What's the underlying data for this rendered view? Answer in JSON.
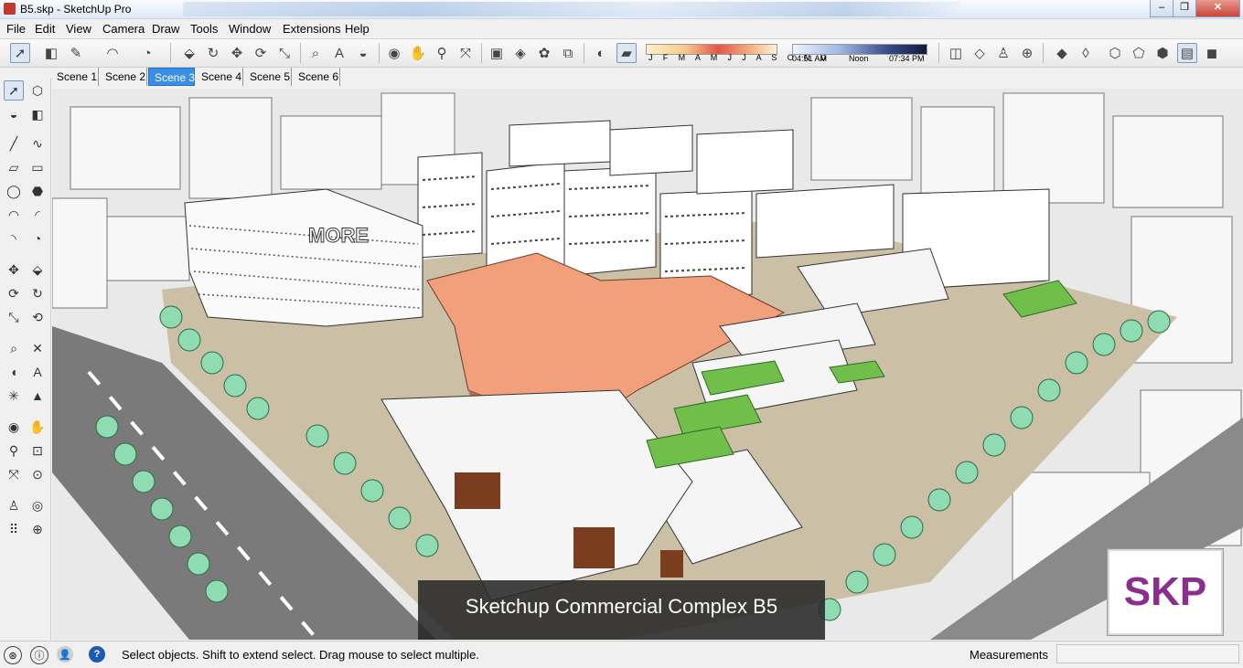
{
  "window": {
    "title": "B5.skp - SketchUp Pro",
    "minimize": "–",
    "maximize": "❐",
    "close": "✕"
  },
  "menu": [
    "File",
    "Edit",
    "View",
    "Camera",
    "Draw",
    "Tools",
    "Window",
    "Extensions",
    "Help"
  ],
  "toolbar": {
    "shadow_months": "J F M A M J J A S O N D",
    "time_start": "04:51 AM",
    "time_mid": "Noon",
    "time_end": "07:34 PM"
  },
  "scenes": [
    {
      "label": "Scene 1",
      "active": false
    },
    {
      "label": "Scene 2",
      "active": false
    },
    {
      "label": "Scene 3",
      "active": true
    },
    {
      "label": "Scene 4",
      "active": false
    },
    {
      "label": "Scene 5",
      "active": false
    },
    {
      "label": "Scene 6",
      "active": false
    }
  ],
  "viewport": {
    "caption": "Sketchup Commercial Complex B5",
    "badge": "SKP",
    "building_sign": "MORE"
  },
  "statusbar": {
    "hint": "Select objects. Shift to extend select. Drag mouse to select multiple.",
    "measurements_label": "Measurements",
    "measurements_value": ""
  },
  "colors": {
    "accent": "#3a8ee6",
    "roof_orange": "#f2a07b",
    "green_roof": "#6fbf4a",
    "tree_cyl": "#8fdcb2",
    "road": "#7a7a7a"
  }
}
